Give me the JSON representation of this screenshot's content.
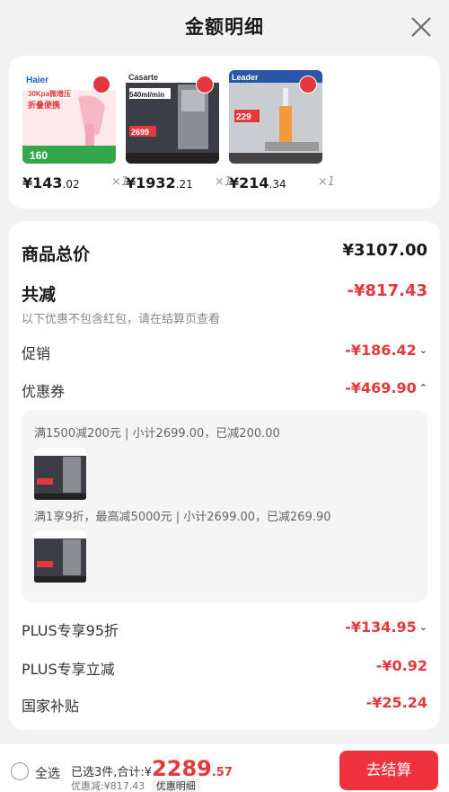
{
  "header": {
    "title": "金额明细"
  },
  "products": [
    {
      "price_int": "¥143",
      "price_dec": ".02",
      "qty": "×1",
      "brand": "Haier",
      "tag1": "30Kpa微增压",
      "tag2": "折叠便携",
      "sale": "160"
    },
    {
      "price_int": "¥1932",
      "price_dec": ".21",
      "qty": "×1",
      "brand": "Casarte",
      "tag1": "540ml/min",
      "tag2": "2699"
    },
    {
      "price_int": "¥214",
      "price_dec": ".34",
      "qty": "×1",
      "brand": "Leader",
      "tag1": "229"
    }
  ],
  "detail": {
    "total_label": "商品总价",
    "total_value": "¥3107.00",
    "reduce_label": "共减",
    "reduce_value": "-¥817.43",
    "note": "以下优惠不包含红包，请在结算页查看",
    "promo_label": "促销",
    "promo_value": "-¥186.42",
    "coupon_label": "优惠券",
    "coupon_value": "-¥469.90",
    "coupons": [
      {
        "text": "满1500减200元 | 小计2699.00，已减200.00"
      },
      {
        "text": "满1享9折，最高减5000元 | 小计2699.00，已减269.90"
      }
    ],
    "plus95_label": "PLUS专享95折",
    "plus95_value": "-¥134.95",
    "plusdirect_label": "PLUS专享立减",
    "plusdirect_value": "-¥0.92",
    "subsidy_label": "国家补贴",
    "subsidy_value": "-¥25.24"
  },
  "bottom": {
    "select_all": "全选",
    "selected_prefix": "已选3件,合计:¥",
    "total_int": "2289",
    "total_dec": ".57",
    "discount_text": "优惠减:¥817.43",
    "detail_chip": "优惠明细",
    "checkout": "去结算"
  },
  "colors": {
    "accent": "#e4393c",
    "checkout_bg": "#f0323c"
  }
}
